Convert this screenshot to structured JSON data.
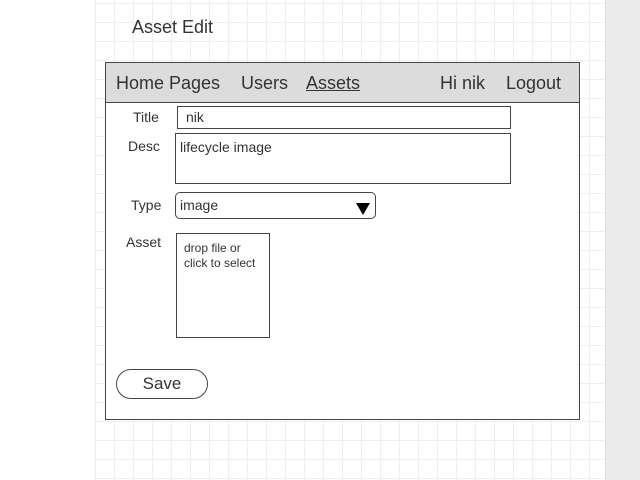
{
  "page_title": "Asset Edit",
  "nav": {
    "home": "Home Pages",
    "users": "Users",
    "assets": "Assets",
    "greeting": "Hi nik",
    "logout": "Logout"
  },
  "form": {
    "title_label": "Title",
    "title_value": "nik",
    "desc_label": "Desc",
    "desc_value": "lifecycle image",
    "type_label": "Type",
    "type_value": "image",
    "asset_label": "Asset",
    "asset_drop_line1": "drop file or",
    "asset_drop_line2": "click to select",
    "save_label": "Save"
  }
}
